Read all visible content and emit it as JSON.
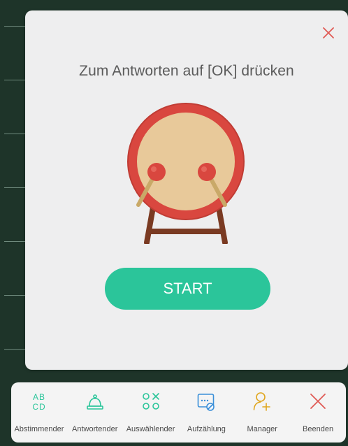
{
  "dialog": {
    "title": "Zum Antworten auf [OK] drücken",
    "start_label": "START"
  },
  "toolbar": {
    "items": [
      {
        "label": "Abstimmender",
        "icon": "abcd-vote-icon"
      },
      {
        "label": "Antwortender",
        "icon": "bell-icon"
      },
      {
        "label": "Auswählender",
        "icon": "select-shapes-icon"
      },
      {
        "label": "Aufzählung",
        "icon": "count-screen-icon"
      },
      {
        "label": "Manager",
        "icon": "add-user-icon"
      },
      {
        "label": "Beenden",
        "icon": "close-icon"
      }
    ]
  },
  "colors": {
    "accent": "#2bc59a",
    "close": "#e05a55",
    "background": "#1e3429",
    "dialog": "#eeeeef",
    "toolbar_icon": "#2bc59a",
    "manager_icon": "#e0a61e"
  }
}
